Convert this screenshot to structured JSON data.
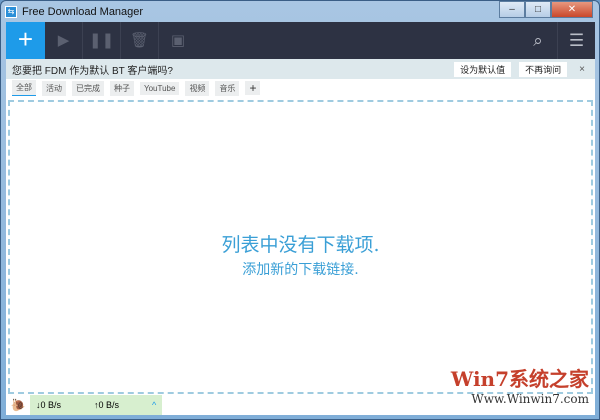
{
  "window": {
    "title": "Free Download Manager",
    "controls": [
      "–",
      "□",
      "✕"
    ]
  },
  "toolbar": {
    "add": "+",
    "start": "▶",
    "pause": "❚❚",
    "delete": "🗑",
    "move": "▣",
    "search": "⌕",
    "menu": "☰"
  },
  "notification": {
    "text": "您要把 FDM 作为默认 BT 客户端吗?",
    "set_default": "设为默认值",
    "dont_ask": "不再询问",
    "close": "×"
  },
  "tabs": [
    "全部",
    "活动",
    "已完成",
    "种子",
    "YouTube",
    "视频",
    "音乐"
  ],
  "tab_add": "+",
  "empty": {
    "title": "列表中没有下载项.",
    "subtitle": "添加新的下载链接."
  },
  "status": {
    "download": "↓0 B/s",
    "upload": "↑0 B/s",
    "expand": "^"
  },
  "watermark": {
    "title": "Win7系统之家",
    "url": "Www.Winwin7.com"
  }
}
